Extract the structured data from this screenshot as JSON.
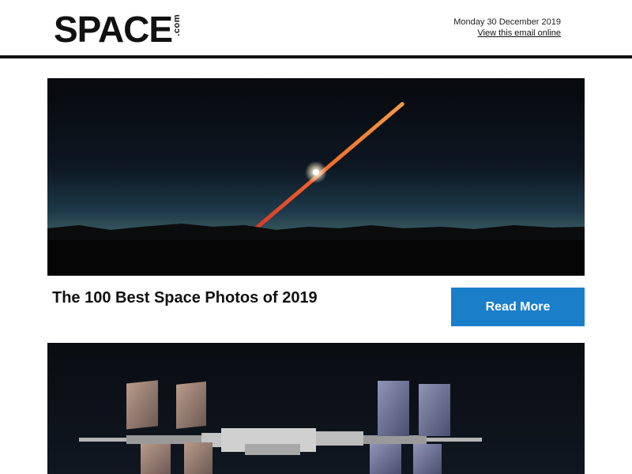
{
  "header": {
    "logo_text": "SPACE",
    "logo_suffix": ".com",
    "date": "Monday 30 December 2019",
    "view_online": "View this email online"
  },
  "articles": [
    {
      "title": "The 100 Best Space Photos of 2019",
      "button_label": "Read More",
      "image": "solar-eclipse-over-mountains"
    },
    {
      "image": "international-space-station"
    }
  ],
  "colors": {
    "accent": "#1a7ec9",
    "rule": "#111111"
  }
}
